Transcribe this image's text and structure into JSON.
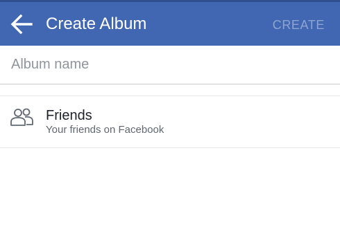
{
  "app_bar": {
    "back_icon": "arrow-left-icon",
    "title": "Create Album",
    "create_label": "CREATE"
  },
  "album_name": {
    "value": "",
    "placeholder": "Album name"
  },
  "privacy": {
    "icon": "friends-icon",
    "title": "Friends",
    "subtitle": "Your friends on Facebook"
  },
  "colors": {
    "app_bar": "#4267b2",
    "create_disabled": "#8ea4d0",
    "primary_text": "#1d2129",
    "secondary_text": "#606770",
    "placeholder": "#90949c"
  }
}
